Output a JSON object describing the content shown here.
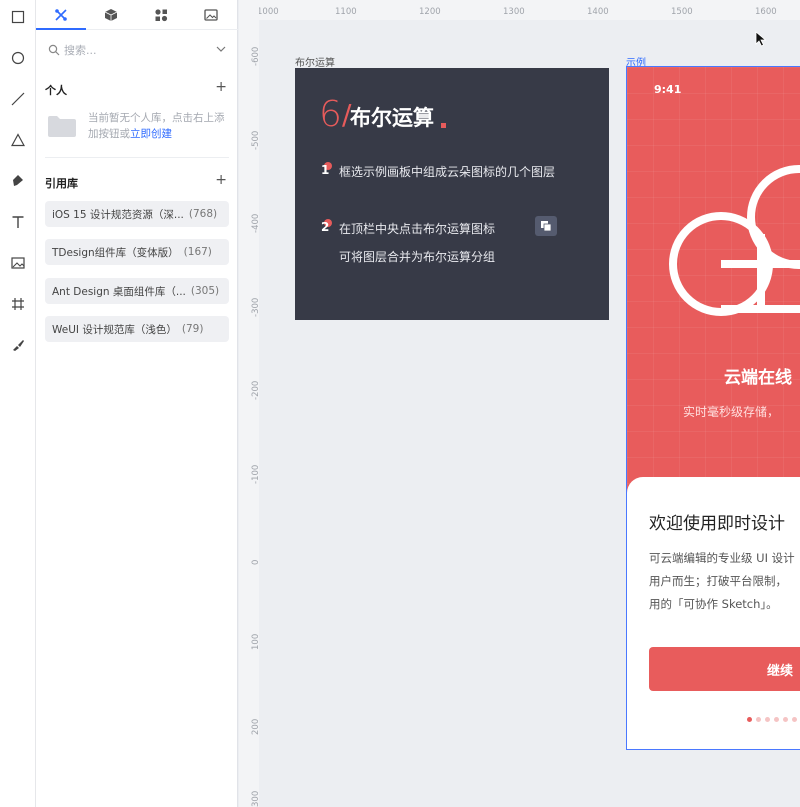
{
  "search": {
    "placeholder": "搜索..."
  },
  "personal": {
    "title": "个人",
    "empty_text": "当前暂无个人库，点击右上添加按钮或",
    "empty_link": "立即创建"
  },
  "library": {
    "title": "引用库",
    "items": [
      {
        "name": "iOS 15 设计规范资源（深...",
        "count": "(768)"
      },
      {
        "name": "TDesign组件库（变体版）",
        "count": "(167)"
      },
      {
        "name": "Ant Design 桌面组件库（...",
        "count": "(305)"
      },
      {
        "name": "WeUI 设计规范库（浅色）",
        "count": "(79)"
      }
    ]
  },
  "rulers": {
    "top": [
      "1000",
      "1100",
      "1200",
      "1300",
      "1400",
      "1500",
      "1600"
    ],
    "left": [
      "-600",
      "-500",
      "-400",
      "-300",
      "-200",
      "-100",
      "0",
      "100",
      "200",
      "300"
    ]
  },
  "boolean_frame": {
    "label": "布尔运算",
    "big_number": "6",
    "slash": "/",
    "title": "布尔运算",
    "step1_num": "1",
    "step1": "框选示例画板中组成云朵图标的几个图层",
    "step2_num": "2",
    "step2_line1": "在顶栏中央点击布尔运算图标",
    "step2_line2": "可将图层合并为布尔运算分组"
  },
  "example_frame": {
    "label": "示例",
    "time": "9:41",
    "cloud_title": "云端在线",
    "cloud_sub": "实时毫秒级存储，",
    "welcome": "欢迎使用即时设计",
    "body_line1": "可云端编辑的专业级 UI 设计",
    "body_line2": "用户而生；打破平台限制，",
    "body_line3": "用的「可协作 Sketch」。",
    "cta": "继续"
  },
  "colors": {
    "accent": "#2f6bff",
    "brand_red": "#e85c5c",
    "dark_board": "#373a47"
  }
}
